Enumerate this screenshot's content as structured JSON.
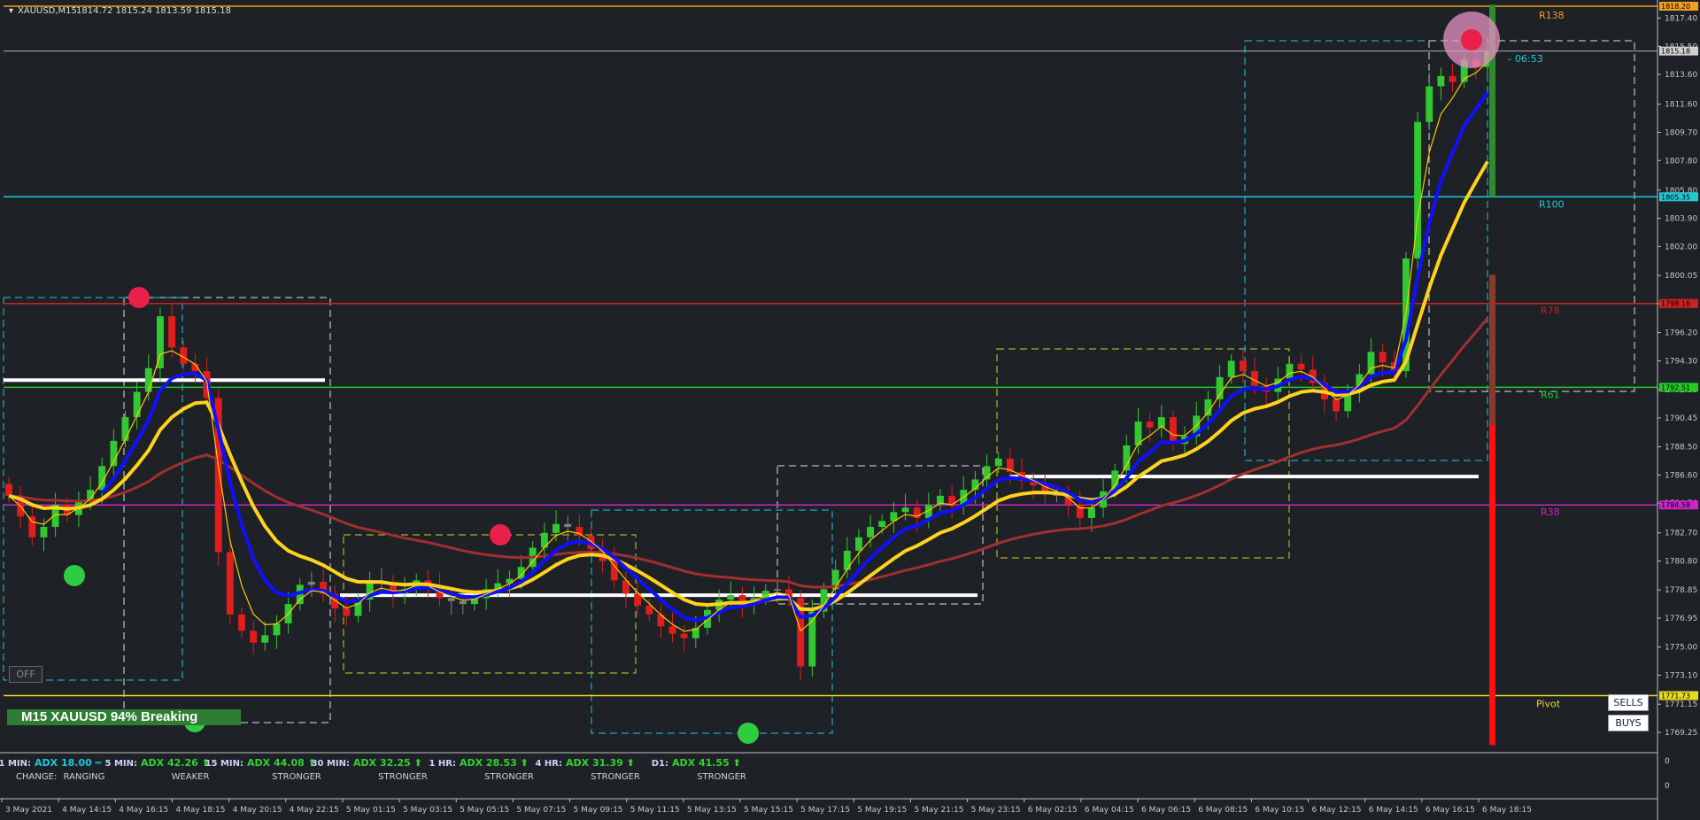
{
  "header": {
    "symbol": "XAUUSD,M15",
    "ohlc": "1814.72 1815.24 1813.59 1815.18"
  },
  "chart_data": {
    "type": "candlestick",
    "ylim": [
      1768.0,
      1818.5
    ],
    "y_ticks": [
      "1817.40",
      "1815.50",
      "1813.60",
      "1811.60",
      "1809.70",
      "1807.80",
      "1805.80",
      "1803.90",
      "1802.00",
      "1800.05",
      "1798.15",
      "1796.20",
      "1794.30",
      "1792.35",
      "1790.45",
      "1788.50",
      "1786.60",
      "1784.70",
      "1782.70",
      "1780.80",
      "1778.85",
      "1776.95",
      "1775.00",
      "1773.10",
      "1771.15",
      "1769.25"
    ],
    "x_ticks": [
      "3 May 2021",
      "4 May 14:15",
      "4 May 16:15",
      "4 May 18:15",
      "4 May 20:15",
      "4 May 22:15",
      "5 May 01:15",
      "5 May 03:15",
      "5 May 05:15",
      "5 May 07:15",
      "5 May 09:15",
      "5 May 11:15",
      "5 May 13:15",
      "5 May 15:15",
      "5 May 17:15",
      "5 May 19:15",
      "5 May 21:15",
      "5 May 23:15",
      "6 May 02:15",
      "6 May 04:15",
      "6 May 06:15",
      "6 May 08:15",
      "6 May 10:15",
      "6 May 12:15",
      "6 May 14:15",
      "6 May 16:15",
      "6 May 18:15"
    ],
    "price_tags": [
      {
        "label": "1818.20",
        "value": 1818.2,
        "color": "#f0a020"
      },
      {
        "label": "1815.18",
        "value": 1815.18,
        "color": "#d0d0d0"
      },
      {
        "label": "1805.35",
        "value": 1805.35,
        "color": "#20c8d8"
      },
      {
        "label": "1798.16",
        "value": 1798.16,
        "color": "#cc2222"
      },
      {
        "label": "1792.51",
        "value": 1792.51,
        "color": "#22cc22"
      },
      {
        "label": "1784.58",
        "value": 1784.58,
        "color": "#cc22cc"
      },
      {
        "label": "1771.73",
        "value": 1771.73,
        "color": "#e8d820"
      }
    ],
    "levels": [
      {
        "name": "R138",
        "value": 1818.2,
        "color": "#f0a020"
      },
      {
        "name": "R100",
        "value": 1805.35,
        "color": "#20c8d8"
      },
      {
        "name": "R78",
        "value": 1798.16,
        "color": "#cc2222"
      },
      {
        "name": "R61",
        "value": 1792.51,
        "color": "#22cc22"
      },
      {
        "name": "R38",
        "value": 1784.58,
        "color": "#cc22cc"
      },
      {
        "name": "Pivot",
        "value": 1771.73,
        "color": "#e8d820"
      }
    ],
    "countdown": "06:53",
    "closes": [
      1785.2,
      1783.8,
      1782.4,
      1783.1,
      1784.6,
      1783.9,
      1784.8,
      1785.6,
      1787.2,
      1788.9,
      1790.5,
      1792.2,
      1793.8,
      1797.3,
      1795.2,
      1794.1,
      1793.6,
      1791.8,
      1781.4,
      1777.2,
      1776.1,
      1775.3,
      1775.8,
      1776.6,
      1777.9,
      1779.2,
      1779.4,
      1778.6,
      1777.6,
      1777.1,
      1778.2,
      1779.4,
      1779.3,
      1778.6,
      1778.9,
      1779.5,
      1779.1,
      1778.3,
      1778.1,
      1777.9,
      1778.3,
      1778.9,
      1779.3,
      1779.6,
      1780.4,
      1781.7,
      1782.7,
      1783.3,
      1783.1,
      1782.5,
      1781.6,
      1780.8,
      1779.5,
      1778.6,
      1777.8,
      1777.2,
      1776.4,
      1775.9,
      1775.6,
      1776.3,
      1777.5,
      1778.2,
      1778.5,
      1777.9,
      1778.3,
      1778.8,
      1778.9,
      1778.3,
      1773.7,
      1777.4,
      1778.9,
      1780.2,
      1781.5,
      1782.4,
      1783.1,
      1783.5,
      1784.1,
      1784.4,
      1783.7,
      1784.6,
      1785.2,
      1784.5,
      1785.6,
      1786.3,
      1787.2,
      1787.7,
      1786.8,
      1786.2,
      1785.9,
      1785.4,
      1785.2,
      1784.6,
      1783.7,
      1784.4,
      1785.5,
      1786.9,
      1788.6,
      1790.2,
      1789.8,
      1790.5,
      1788.7,
      1789.2,
      1790.6,
      1791.7,
      1793.2,
      1794.3,
      1793.6,
      1792.6,
      1792.2,
      1793.1,
      1794.1,
      1793.7,
      1792.8,
      1791.7,
      1790.9,
      1792.3,
      1793.4,
      1794.9,
      1794.2,
      1793.6,
      1801.2,
      1810.4,
      1812.8,
      1813.5,
      1813.1,
      1814.6,
      1814.1,
      1815.18
    ],
    "indicators": {
      "labels": [
        "1 MIN:",
        "5 MIN:",
        "15 MIN:",
        "30 MIN:",
        "1 HR:",
        "4 HR:",
        "D1:"
      ],
      "adx": [
        "ADX 18.00",
        "ADX 42.26",
        "ADX 44.08",
        "ADX 32.25",
        "ADX 28.53",
        "ADX 31.39",
        "ADX 41.55"
      ],
      "change_label": "CHANGE:",
      "change": [
        "RANGING",
        "WEAKER",
        "STRONGER",
        "STRONGER",
        "STRONGER",
        "STRONGER",
        "STRONGER"
      ]
    },
    "sub_axis": [
      "0",
      "0"
    ]
  },
  "badge_text": "M15 XAUUSD 94% Breaking",
  "off_label": "OFF",
  "sells_label": "SELLS",
  "buys_label": "BUYS",
  "colors": {
    "up": "#32c832",
    "down": "#e01e1e",
    "neutral": "#808080",
    "ema_fast": "#1010ff",
    "ema_mid": "#ffd21e",
    "ma_slow": "#a03030"
  }
}
